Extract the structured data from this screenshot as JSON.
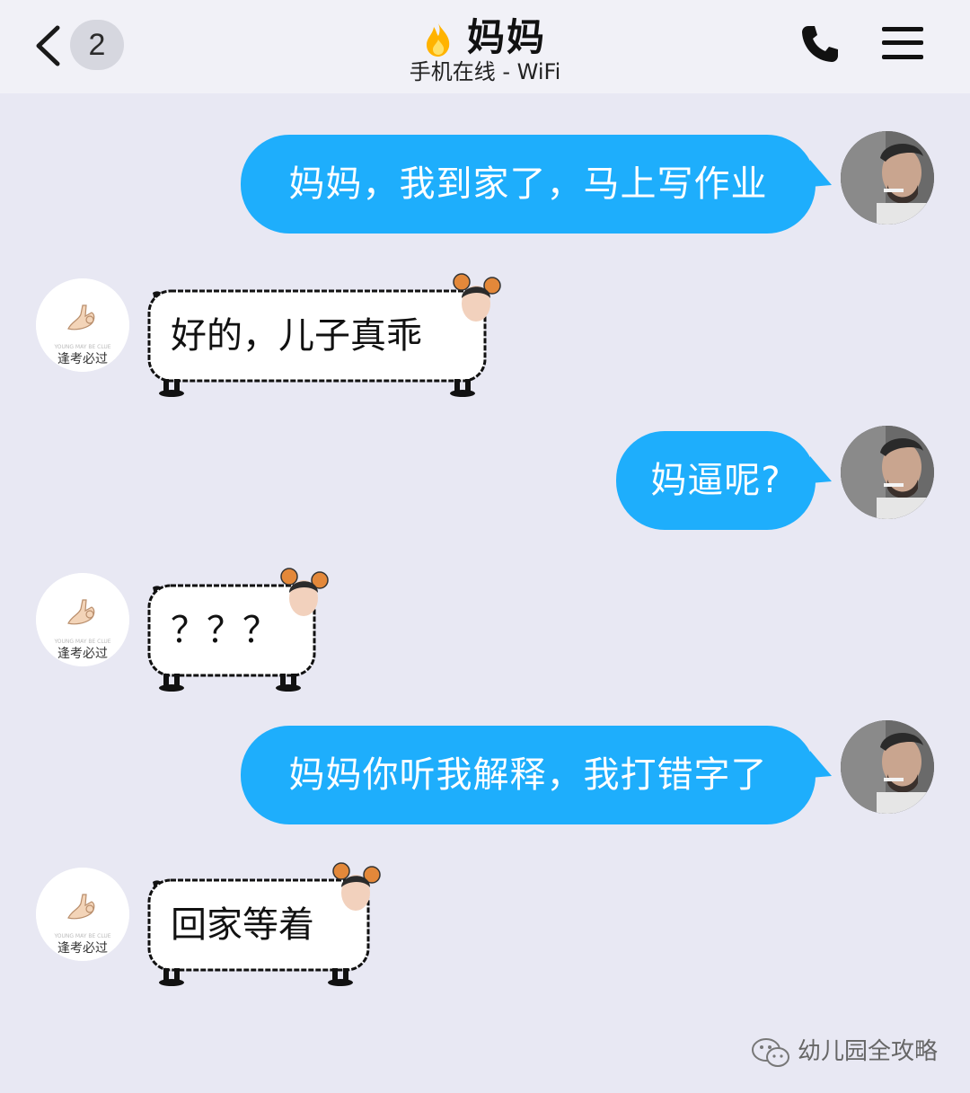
{
  "header": {
    "back_icon": "chevron-left-icon",
    "unread_count": "2",
    "title": "妈妈",
    "title_icon": "flame-icon",
    "status": "手机在线 - WiFi",
    "call_icon": "phone-icon",
    "menu_icon": "hamburger-menu-icon"
  },
  "colors": {
    "outgoing_bubble": "#1eaefc",
    "background": "#e8e8f3",
    "header_bg": "#f1f1f7"
  },
  "messages": [
    {
      "sender": "me",
      "text": "妈妈，我到家了，马上写作业"
    },
    {
      "sender": "mom",
      "text": "好的，儿子真乖"
    },
    {
      "sender": "me",
      "text": "妈逼呢?"
    },
    {
      "sender": "mom",
      "text": "？？？"
    },
    {
      "sender": "me",
      "text": "妈妈你听我解释，我打错字了"
    },
    {
      "sender": "mom",
      "text": "回家等着"
    }
  ],
  "mom_avatar": {
    "caption": "逢考必过",
    "small_text": "YOUNG MAY BE CLUE"
  },
  "watermark": {
    "icon": "wechat-icon",
    "text": "幼儿园全攻略"
  }
}
